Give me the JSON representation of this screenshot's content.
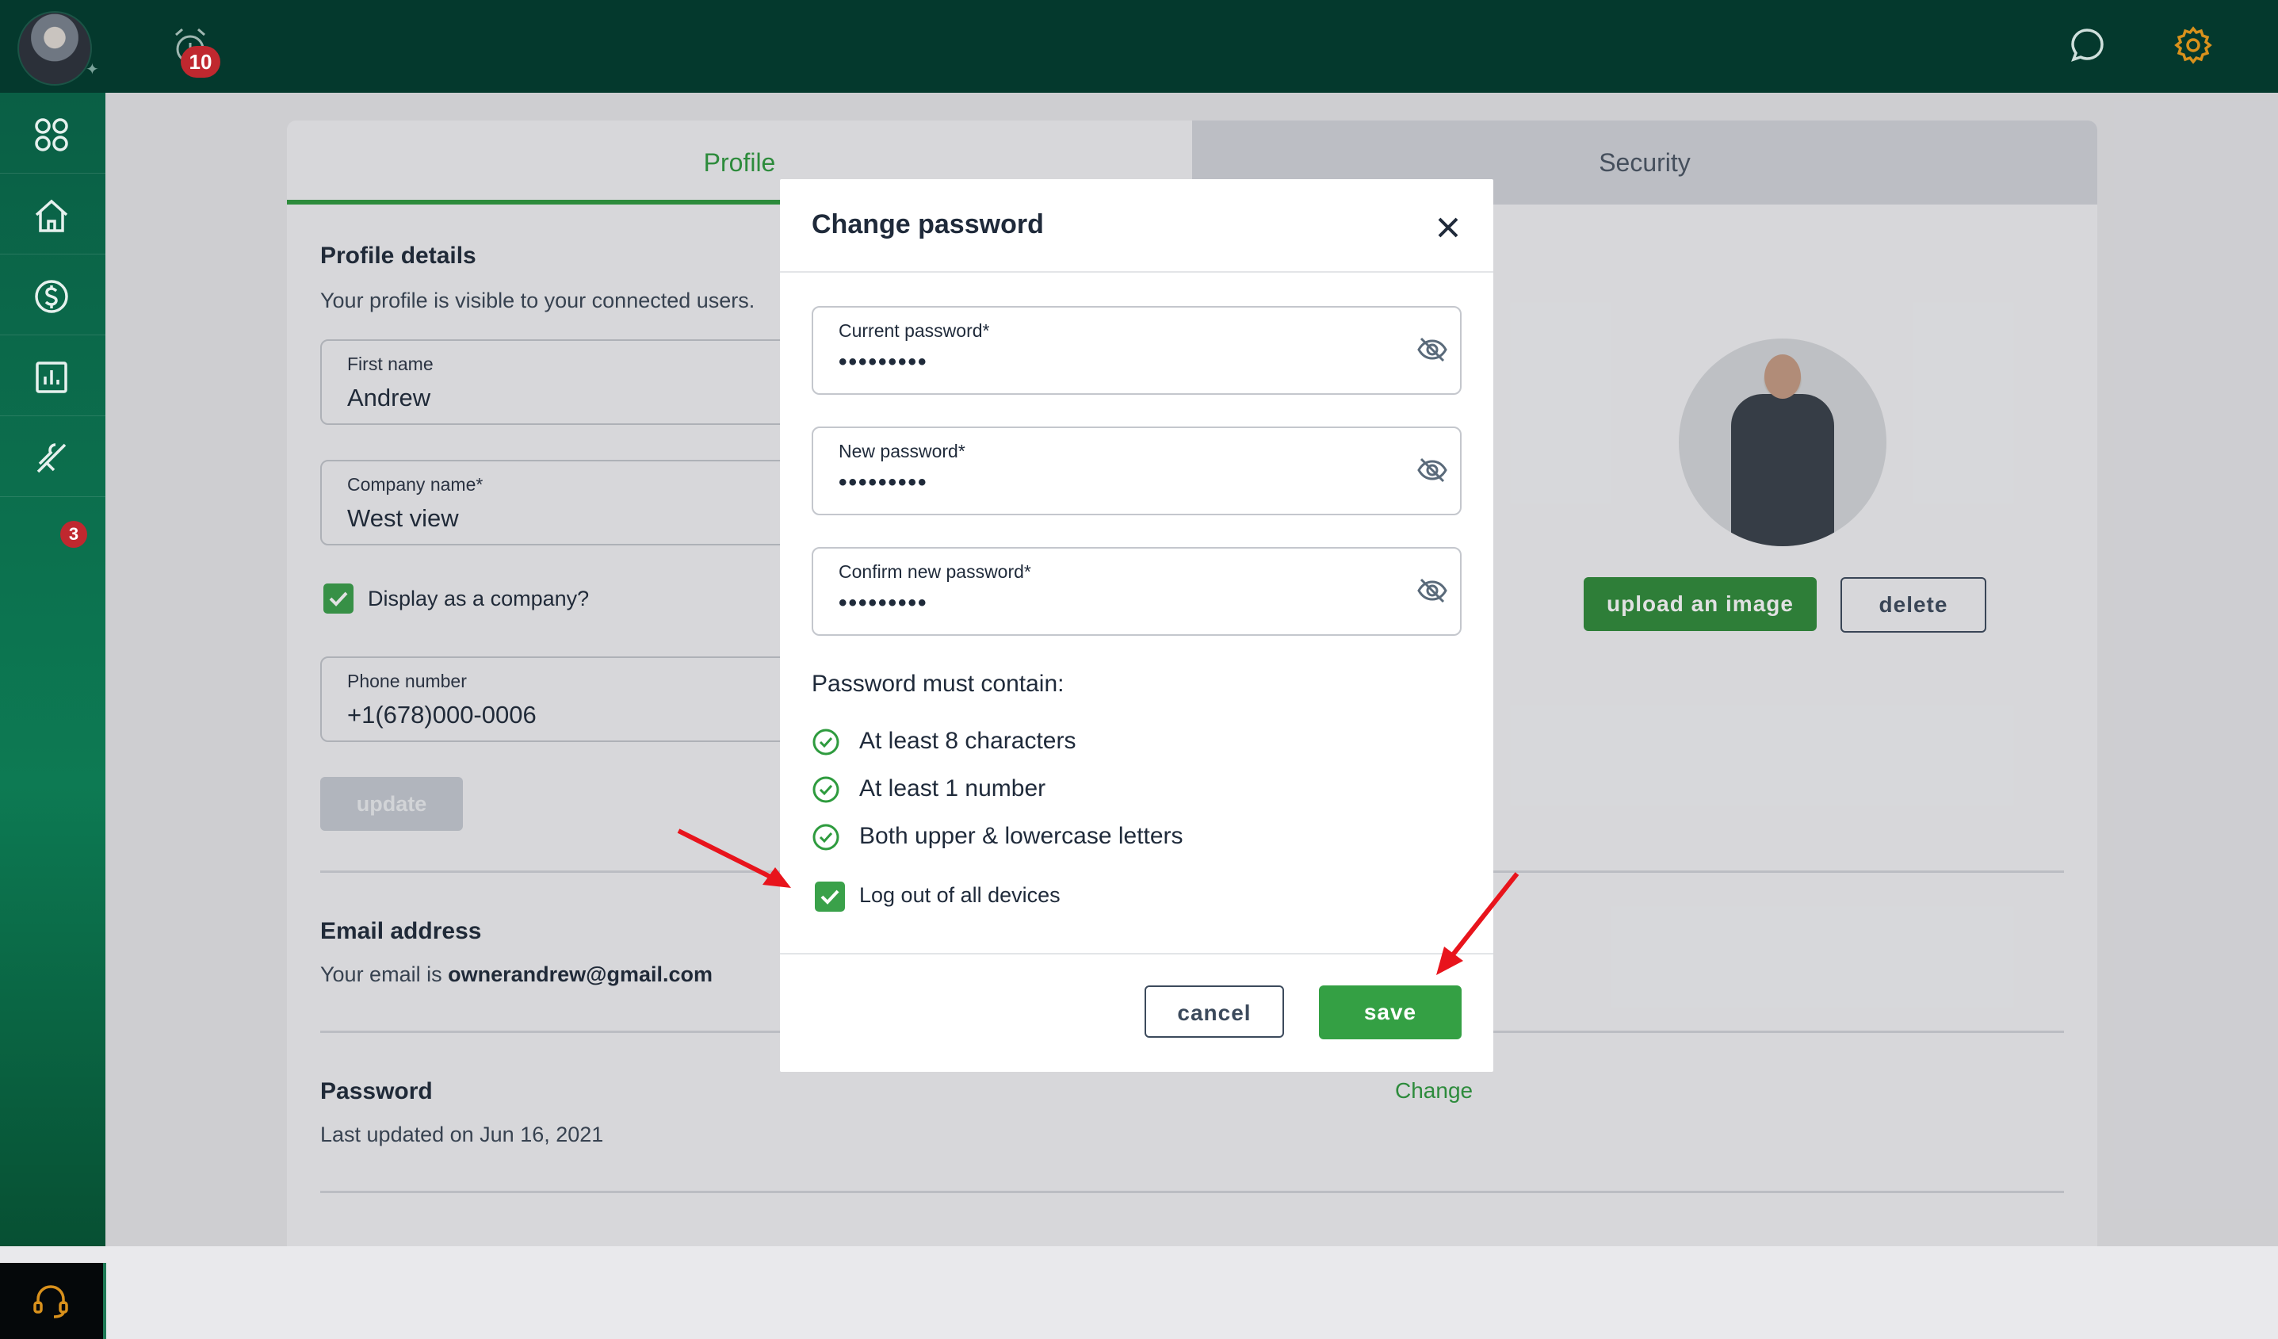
{
  "topbar": {
    "alarm_count": "10"
  },
  "sidebar": {
    "tools_badge": "3"
  },
  "tabs": {
    "profile": "Profile",
    "security": "Security"
  },
  "profile": {
    "heading": "Profile details",
    "subtitle": "Your profile is visible to your connected users.",
    "first_name_label": "First name",
    "first_name_value": "Andrew",
    "company_label": "Company name*",
    "company_value": "West view",
    "display_company_label": "Display as a company?",
    "phone_label": "Phone number",
    "phone_value": "+1(678)000-0006",
    "update_label": "update",
    "upload_label": "upload an image",
    "delete_label": "delete"
  },
  "email": {
    "heading": "Email address",
    "prefix": "Your email is",
    "address": "ownerandrew@gmail.com"
  },
  "password_section": {
    "heading": "Password",
    "updated": "Last updated on Jun 16, 2021",
    "change_label": "Change"
  },
  "modal": {
    "title": "Change password",
    "current_label": "Current password*",
    "current_value": "•••••••••",
    "new_label": "New password*",
    "new_value": "•••••••••",
    "confirm_label": "Confirm new password*",
    "confirm_value": "•••••••••",
    "requirements_title": "Password must contain:",
    "requirements": [
      "At least 8 characters",
      "At least 1 number",
      "Both upper & lowercase letters"
    ],
    "logout_label": "Log out of all devices",
    "cancel_label": "cancel",
    "save_label": "save"
  },
  "colors": {
    "accent": "#2e9b3e",
    "topbar": "#04392d",
    "badge": "#c0282f",
    "arrow": "#e8141c"
  },
  "icons": [
    "alarm-icon",
    "chat-icon",
    "gear-icon",
    "apps-icon",
    "home-icon",
    "dollar-icon",
    "chart-icon",
    "tools-icon",
    "headset-icon",
    "close-icon",
    "eye-off-icon",
    "check-circle-icon"
  ]
}
